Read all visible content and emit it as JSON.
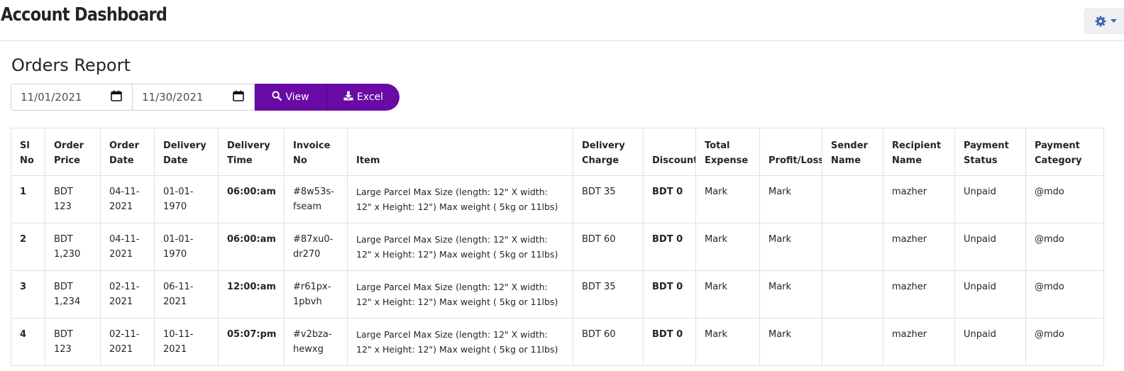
{
  "header": {
    "title": "Account Dashboard",
    "settings_icon": "gear-icon"
  },
  "report": {
    "title": "Orders Report",
    "start_date": "11/01/2021",
    "end_date": "11/30/2021",
    "view_label": "View",
    "excel_label": "Excel",
    "accent_color": "#6a0aa4"
  },
  "table": {
    "columns": [
      "Sl No",
      "Order Price",
      "Order Date",
      "Delivery Date",
      "Delivery Time",
      "Invoice No",
      "Item",
      "Delivery Charge",
      "Discount",
      "Total Expense",
      "Profit/Loss",
      "Sender Name",
      "Recipient Name",
      "Payment Status",
      "Payment Category"
    ],
    "rows": [
      [
        "1",
        "BDT 123",
        "04-11-2021",
        "01-01-1970",
        "06:00:am",
        "#8w53s-fseam",
        "Large Parcel Max Size (length: 12\" X width: 12\" x Height: 12\") Max weight ( 5kg or 11lbs)",
        "BDT 35",
        "BDT 0",
        "Mark",
        "Mark",
        "",
        "mazher",
        "Unpaid",
        "@mdo"
      ],
      [
        "2",
        "BDT 1,230",
        "04-11-2021",
        "01-01-1970",
        "06:00:am",
        "#87xu0-dr270",
        "Large Parcel Max Size (length: 12\" X width: 12\" x Height: 12\") Max weight ( 5kg or 11lbs)",
        "BDT 60",
        "BDT 0",
        "Mark",
        "Mark",
        "",
        "mazher",
        "Unpaid",
        "@mdo"
      ],
      [
        "3",
        "BDT 1,234",
        "02-11-2021",
        "06-11-2021",
        "12:00:am",
        "#r61px-1pbvh",
        "Large Parcel Max Size (length: 12\" X width: 12\" x Height: 12\") Max weight ( 5kg or 11lbs)",
        "BDT 35",
        "BDT 0",
        "Mark",
        "Mark",
        "",
        "mazher",
        "Unpaid",
        "@mdo"
      ],
      [
        "4",
        "BDT 123",
        "02-11-2021",
        "10-11-2021",
        "05:07:pm",
        "#v2bza-hewxg",
        "Large Parcel Max Size (length: 12\" X width: 12\" x Height: 12\") Max weight ( 5kg or 11lbs)",
        "BDT 60",
        "BDT 0",
        "Mark",
        "Mark",
        "",
        "mazher",
        "Unpaid",
        "@mdo"
      ]
    ]
  }
}
